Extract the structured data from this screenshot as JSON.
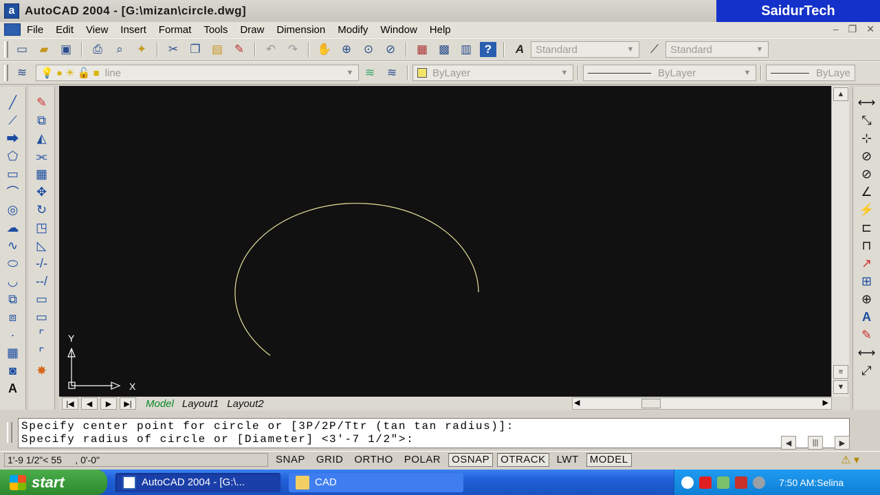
{
  "window": {
    "app_icon_letter": "a",
    "title": "AutoCAD 2004 - [G:\\mizan\\circle.dwg]",
    "watermark": "SaidurTech",
    "controls": [
      "–",
      "❐",
      "✕"
    ]
  },
  "menu": [
    "File",
    "Edit",
    "View",
    "Insert",
    "Format",
    "Tools",
    "Draw",
    "Dimension",
    "Modify",
    "Window",
    "Help"
  ],
  "toolbar_standard": {
    "text_style": "Standard",
    "dim_style": "Standard"
  },
  "toolbar_layers": {
    "layer": "line",
    "color": "ByLayer",
    "linetype": "ByLayer",
    "lineweight": "ByLaye"
  },
  "ucs": {
    "y_label": "Y",
    "x_label": "X"
  },
  "tabs": [
    "Model",
    "Layout1",
    "Layout2"
  ],
  "command_line": [
    "Specify center point for circle or [3P/2P/Ttr (tan tan radius)]:",
    "Specify radius of circle or [Diameter] <3'-7 1/2\">:"
  ],
  "status": {
    "coordinates": "1'-9 1/2\"< 55     , 0'-0\"",
    "buttons": [
      {
        "label": "SNAP",
        "on": false
      },
      {
        "label": "GRID",
        "on": false
      },
      {
        "label": "ORTHO",
        "on": false
      },
      {
        "label": "POLAR",
        "on": false
      },
      {
        "label": "OSNAP",
        "on": true
      },
      {
        "label": "OTRACK",
        "on": true
      },
      {
        "label": "LWT",
        "on": false
      },
      {
        "label": "MODEL",
        "on": true
      }
    ]
  },
  "taskbar": {
    "start": "start",
    "tasks": [
      "AutoCAD 2004 - [G:\\...",
      "CAD"
    ],
    "clock": "7:50 AM:Selina"
  },
  "colors": {
    "canvas": "#111112",
    "arc": "#e8e39a",
    "crosshair": "#ffffff"
  }
}
